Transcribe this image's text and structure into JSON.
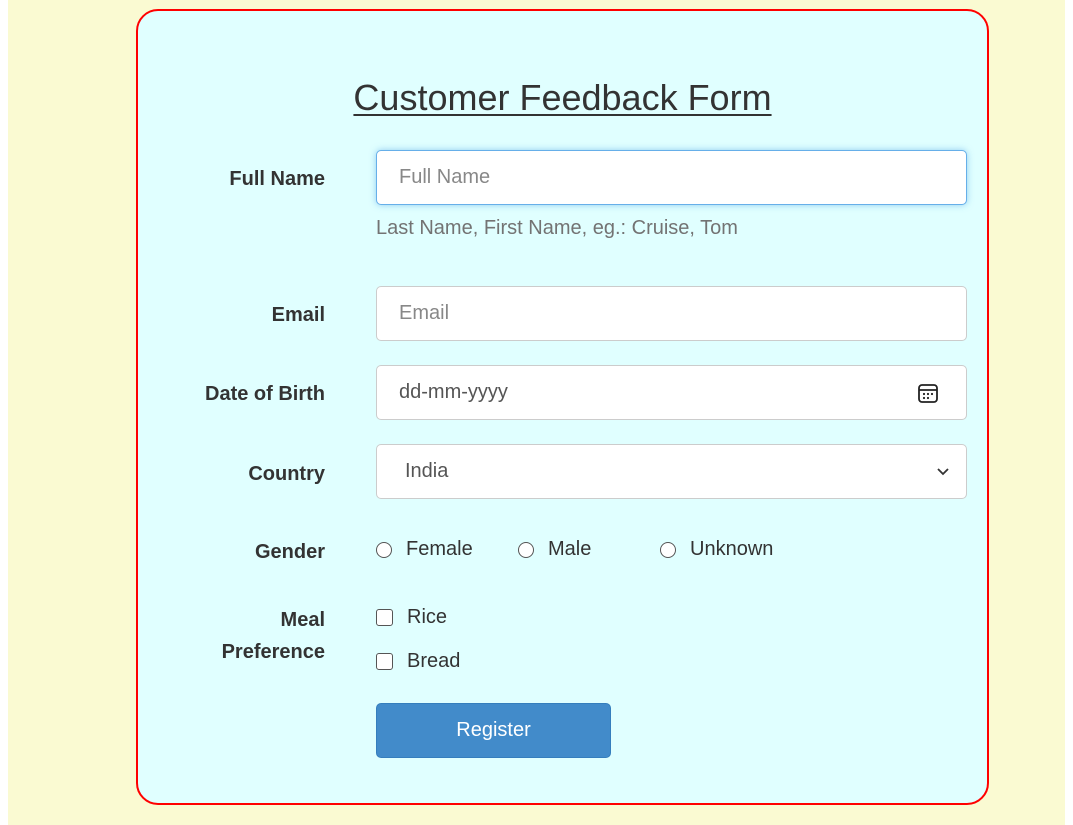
{
  "form": {
    "title": "Customer Feedback Form",
    "full_name": {
      "label": "Full Name",
      "placeholder": "Full Name",
      "help": "Last Name, First Name, eg.: Cruise, Tom"
    },
    "email": {
      "label": "Email",
      "placeholder": "Email"
    },
    "dob": {
      "label": "Date of Birth",
      "value": "dd-mm-yyyy"
    },
    "country": {
      "label": "Country",
      "selected": "India"
    },
    "gender": {
      "label": "Gender",
      "options": [
        "Female",
        "Male",
        "Unknown"
      ]
    },
    "meal": {
      "label_line1": "Meal",
      "label_line2": "Preference",
      "options": [
        "Rice",
        "Bread"
      ]
    },
    "submit_label": "Register"
  },
  "colors": {
    "page_background": "#fafad2",
    "card_background": "#e0ffff",
    "card_border": "#ff0000",
    "button": "#428bca"
  },
  "icons": {
    "date": "calendar-icon",
    "select": "chevron-down-icon"
  }
}
